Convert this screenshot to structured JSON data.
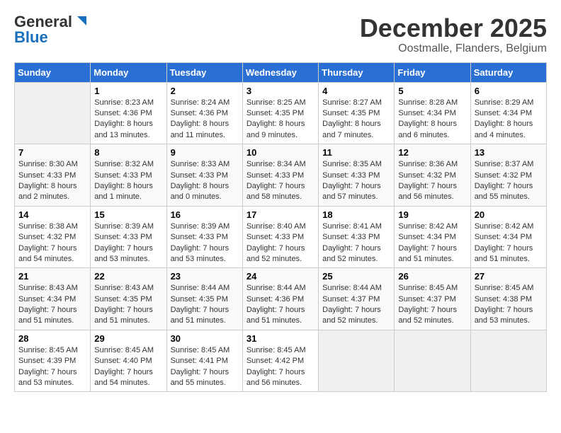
{
  "header": {
    "logo_general": "General",
    "logo_blue": "Blue",
    "title": "December 2025",
    "location": "Oostmalle, Flanders, Belgium"
  },
  "days_of_week": [
    "Sunday",
    "Monday",
    "Tuesday",
    "Wednesday",
    "Thursday",
    "Friday",
    "Saturday"
  ],
  "weeks": [
    [
      {
        "day": "",
        "sunrise": "",
        "sunset": "",
        "daylight": ""
      },
      {
        "day": "1",
        "sunrise": "Sunrise: 8:23 AM",
        "sunset": "Sunset: 4:36 PM",
        "daylight": "Daylight: 8 hours and 13 minutes."
      },
      {
        "day": "2",
        "sunrise": "Sunrise: 8:24 AM",
        "sunset": "Sunset: 4:36 PM",
        "daylight": "Daylight: 8 hours and 11 minutes."
      },
      {
        "day": "3",
        "sunrise": "Sunrise: 8:25 AM",
        "sunset": "Sunset: 4:35 PM",
        "daylight": "Daylight: 8 hours and 9 minutes."
      },
      {
        "day": "4",
        "sunrise": "Sunrise: 8:27 AM",
        "sunset": "Sunset: 4:35 PM",
        "daylight": "Daylight: 8 hours and 7 minutes."
      },
      {
        "day": "5",
        "sunrise": "Sunrise: 8:28 AM",
        "sunset": "Sunset: 4:34 PM",
        "daylight": "Daylight: 8 hours and 6 minutes."
      },
      {
        "day": "6",
        "sunrise": "Sunrise: 8:29 AM",
        "sunset": "Sunset: 4:34 PM",
        "daylight": "Daylight: 8 hours and 4 minutes."
      }
    ],
    [
      {
        "day": "7",
        "sunrise": "Sunrise: 8:30 AM",
        "sunset": "Sunset: 4:33 PM",
        "daylight": "Daylight: 8 hours and 2 minutes."
      },
      {
        "day": "8",
        "sunrise": "Sunrise: 8:32 AM",
        "sunset": "Sunset: 4:33 PM",
        "daylight": "Daylight: 8 hours and 1 minute."
      },
      {
        "day": "9",
        "sunrise": "Sunrise: 8:33 AM",
        "sunset": "Sunset: 4:33 PM",
        "daylight": "Daylight: 8 hours and 0 minutes."
      },
      {
        "day": "10",
        "sunrise": "Sunrise: 8:34 AM",
        "sunset": "Sunset: 4:33 PM",
        "daylight": "Daylight: 7 hours and 58 minutes."
      },
      {
        "day": "11",
        "sunrise": "Sunrise: 8:35 AM",
        "sunset": "Sunset: 4:33 PM",
        "daylight": "Daylight: 7 hours and 57 minutes."
      },
      {
        "day": "12",
        "sunrise": "Sunrise: 8:36 AM",
        "sunset": "Sunset: 4:32 PM",
        "daylight": "Daylight: 7 hours and 56 minutes."
      },
      {
        "day": "13",
        "sunrise": "Sunrise: 8:37 AM",
        "sunset": "Sunset: 4:32 PM",
        "daylight": "Daylight: 7 hours and 55 minutes."
      }
    ],
    [
      {
        "day": "14",
        "sunrise": "Sunrise: 8:38 AM",
        "sunset": "Sunset: 4:32 PM",
        "daylight": "Daylight: 7 hours and 54 minutes."
      },
      {
        "day": "15",
        "sunrise": "Sunrise: 8:39 AM",
        "sunset": "Sunset: 4:33 PM",
        "daylight": "Daylight: 7 hours and 53 minutes."
      },
      {
        "day": "16",
        "sunrise": "Sunrise: 8:39 AM",
        "sunset": "Sunset: 4:33 PM",
        "daylight": "Daylight: 7 hours and 53 minutes."
      },
      {
        "day": "17",
        "sunrise": "Sunrise: 8:40 AM",
        "sunset": "Sunset: 4:33 PM",
        "daylight": "Daylight: 7 hours and 52 minutes."
      },
      {
        "day": "18",
        "sunrise": "Sunrise: 8:41 AM",
        "sunset": "Sunset: 4:33 PM",
        "daylight": "Daylight: 7 hours and 52 minutes."
      },
      {
        "day": "19",
        "sunrise": "Sunrise: 8:42 AM",
        "sunset": "Sunset: 4:34 PM",
        "daylight": "Daylight: 7 hours and 51 minutes."
      },
      {
        "day": "20",
        "sunrise": "Sunrise: 8:42 AM",
        "sunset": "Sunset: 4:34 PM",
        "daylight": "Daylight: 7 hours and 51 minutes."
      }
    ],
    [
      {
        "day": "21",
        "sunrise": "Sunrise: 8:43 AM",
        "sunset": "Sunset: 4:34 PM",
        "daylight": "Daylight: 7 hours and 51 minutes."
      },
      {
        "day": "22",
        "sunrise": "Sunrise: 8:43 AM",
        "sunset": "Sunset: 4:35 PM",
        "daylight": "Daylight: 7 hours and 51 minutes."
      },
      {
        "day": "23",
        "sunrise": "Sunrise: 8:44 AM",
        "sunset": "Sunset: 4:35 PM",
        "daylight": "Daylight: 7 hours and 51 minutes."
      },
      {
        "day": "24",
        "sunrise": "Sunrise: 8:44 AM",
        "sunset": "Sunset: 4:36 PM",
        "daylight": "Daylight: 7 hours and 51 minutes."
      },
      {
        "day": "25",
        "sunrise": "Sunrise: 8:44 AM",
        "sunset": "Sunset: 4:37 PM",
        "daylight": "Daylight: 7 hours and 52 minutes."
      },
      {
        "day": "26",
        "sunrise": "Sunrise: 8:45 AM",
        "sunset": "Sunset: 4:37 PM",
        "daylight": "Daylight: 7 hours and 52 minutes."
      },
      {
        "day": "27",
        "sunrise": "Sunrise: 8:45 AM",
        "sunset": "Sunset: 4:38 PM",
        "daylight": "Daylight: 7 hours and 53 minutes."
      }
    ],
    [
      {
        "day": "28",
        "sunrise": "Sunrise: 8:45 AM",
        "sunset": "Sunset: 4:39 PM",
        "daylight": "Daylight: 7 hours and 53 minutes."
      },
      {
        "day": "29",
        "sunrise": "Sunrise: 8:45 AM",
        "sunset": "Sunset: 4:40 PM",
        "daylight": "Daylight: 7 hours and 54 minutes."
      },
      {
        "day": "30",
        "sunrise": "Sunrise: 8:45 AM",
        "sunset": "Sunset: 4:41 PM",
        "daylight": "Daylight: 7 hours and 55 minutes."
      },
      {
        "day": "31",
        "sunrise": "Sunrise: 8:45 AM",
        "sunset": "Sunset: 4:42 PM",
        "daylight": "Daylight: 7 hours and 56 minutes."
      },
      {
        "day": "",
        "sunrise": "",
        "sunset": "",
        "daylight": ""
      },
      {
        "day": "",
        "sunrise": "",
        "sunset": "",
        "daylight": ""
      },
      {
        "day": "",
        "sunrise": "",
        "sunset": "",
        "daylight": ""
      }
    ]
  ]
}
